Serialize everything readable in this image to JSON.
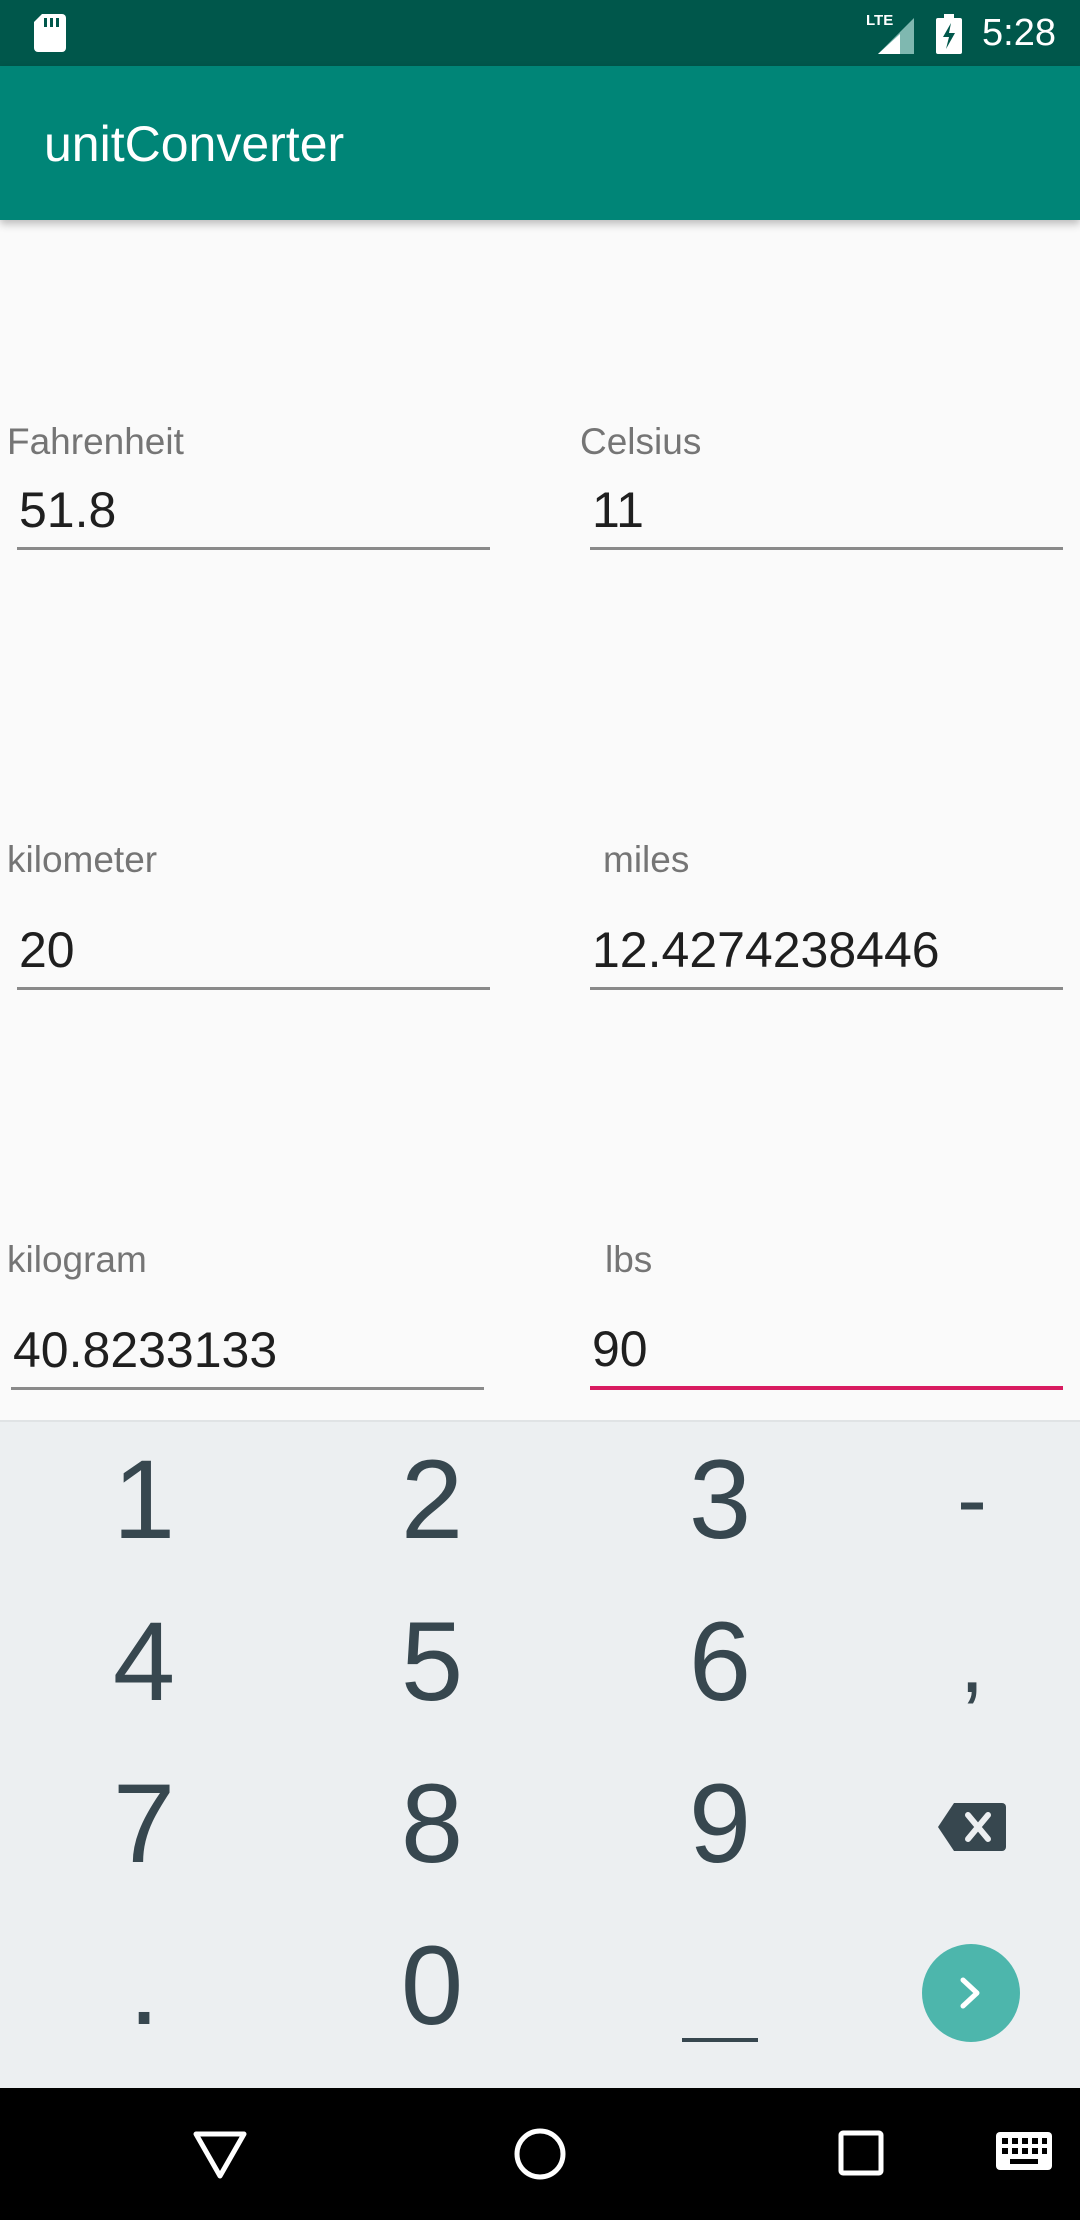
{
  "status_bar": {
    "time": "5:28",
    "network_label": "LTE",
    "icons": [
      "sd-card-icon",
      "lte-signal-icon",
      "battery-charging-icon"
    ]
  },
  "toolbar": {
    "title": "unitConverter"
  },
  "fields": {
    "fahrenheit": {
      "label": "Fahrenheit",
      "value": "51.8"
    },
    "celsius": {
      "label": "Celsius",
      "value": "11"
    },
    "kilometer": {
      "label": "kilometer",
      "value": "20"
    },
    "miles": {
      "label": "miles",
      "value": "12.4274238446"
    },
    "kilogram": {
      "label": "kilogram",
      "value": "40.8233133"
    },
    "lbs": {
      "label": "lbs",
      "value": "90"
    }
  },
  "colors": {
    "primary": "#008577",
    "primary_dark": "#00574b",
    "accent": "#d81b60",
    "keyboard_bg": "#eceff1",
    "key_text": "#37474f",
    "action_key": "#4db6ac"
  },
  "keyboard": {
    "keys": {
      "k1": "1",
      "k2": "2",
      "k3": "3",
      "minus": "-",
      "k4": "4",
      "k5": "5",
      "k6": "6",
      "comma": ",",
      "k7": "7",
      "k8": "8",
      "k9": "9",
      "period": ".",
      "k0": "0"
    },
    "icons": [
      "backspace-icon",
      "next-arrow-icon",
      "space-key"
    ]
  },
  "nav_bar": {
    "icons": [
      "back-triangle-icon",
      "home-circle-icon",
      "recents-square-icon",
      "keyboard-switch-icon"
    ]
  }
}
